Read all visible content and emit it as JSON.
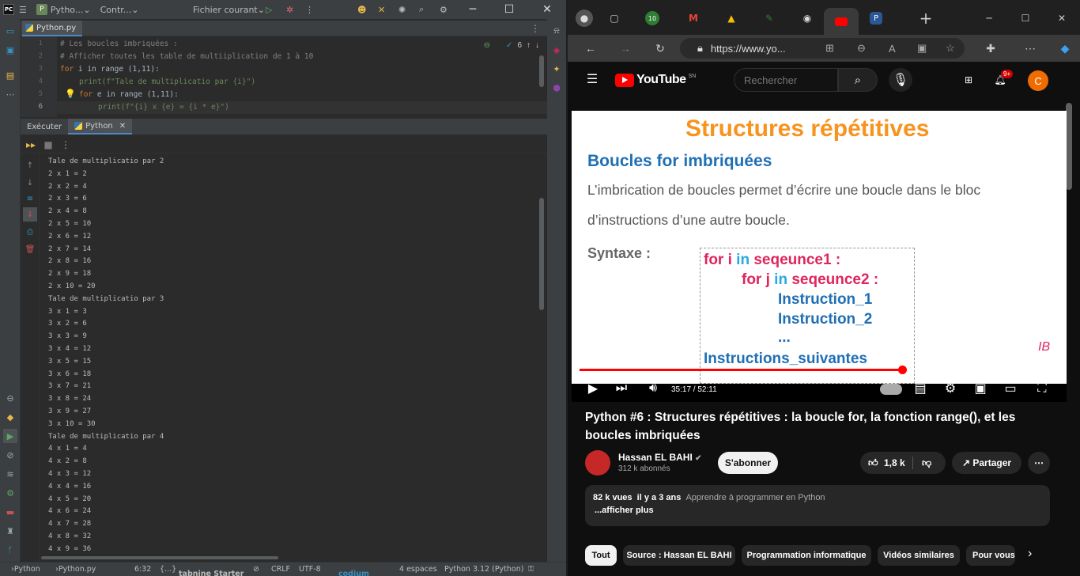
{
  "ide": {
    "project": "Pytho...",
    "project_badge": "P",
    "branch": "Contr...",
    "run_config": "Fichier courant",
    "file_tab": "Python.py",
    "inspection_count": "6",
    "code": {
      "line_numbers": [
        "1",
        "2",
        "3",
        "4",
        "5",
        "6"
      ],
      "l1": "# Les boucles imbriquées :",
      "l2": "# Afficher toutes les table de multiiplication de 1 à 10",
      "l3_kw": "for",
      "l3_rest": " i in range (1,11):",
      "l4": "print(f\"Tale de multiplicatio par {i}\")",
      "l5_kw": "for",
      "l5_rest": " e in range (1,11):",
      "l6": "print(f\"{i} x {e} = {i * e}\")"
    },
    "run_tabs": [
      "Exécuter",
      "Python"
    ],
    "console": [
      "Tale de multiplicatio par 2",
      "2 x 1 = 2",
      "2 x 2 = 4",
      "2 x 3 = 6",
      "2 x 4 = 8",
      "2 x 5 = 10",
      "2 x 6 = 12",
      "2 x 7 = 14",
      "2 x 8 = 16",
      "2 x 9 = 18",
      "2 x 10 = 20",
      "Tale de multiplicatio par 3",
      "3 x 1 = 3",
      "3 x 2 = 6",
      "3 x 3 = 9",
      "3 x 4 = 12",
      "3 x 5 = 15",
      "3 x 6 = 18",
      "3 x 7 = 21",
      "3 x 8 = 24",
      "3 x 9 = 27",
      "3 x 10 = 30",
      "Tale de multiplicatio par 4",
      "4 x 1 = 4",
      "4 x 2 = 8",
      "4 x 3 = 12",
      "4 x 4 = 16",
      "4 x 5 = 20",
      "4 x 6 = 24",
      "4 x 7 = 28",
      "4 x 8 = 32",
      "4 x 9 = 36"
    ],
    "status": {
      "crumb1": "Python",
      "crumb2": "Python.py",
      "pos": "6:32",
      "braces": "{...}",
      "tabnine": "tabnine Starter",
      "crlf": "CRLF",
      "enc": "UTF-8",
      "codium": "codium",
      "indent": "4 espaces",
      "interp": "Python 3.12 (Python)"
    }
  },
  "browser": {
    "url": "https://www.yo...",
    "tab_badge": "10",
    "tab_p": "P",
    "youtube": {
      "logo": "YouTube",
      "region": "SN",
      "search_placeholder": "Rechercher",
      "notif_count": "9+",
      "avatar": "C",
      "slide": {
        "title": "Structures répétitives",
        "subtitle": "Boucles for imbriquées",
        "p1": "L’imbrication de boucles permet d’écrire une boucle dans le bloc",
        "p2": "d’instructions d’une autre boucle.",
        "syntax_label": "Syntaxe :",
        "c1_for": "for",
        "c1_i": "i",
        "c1_in": "in",
        "c1_seq": "seqeunce1 :",
        "c2_for": "for",
        "c2_j": "j",
        "c2_in": "in",
        "c2_seq": "seqeunce2 :",
        "c3": "Instruction_1",
        "c4": "Instruction_2",
        "c5": "...",
        "c6": "Instructions_suivantes",
        "watermark": "IB"
      },
      "progress": 0.674,
      "time": "35:17 / 52:11",
      "video_title": "Python #6 : Structures répétitives : la boucle for, la fonction range(), et les boucles imbriquées",
      "channel": "Hassan EL BAHI",
      "subscribers": "312 k abonnés",
      "subscribe": "S'abonner",
      "likes": "1,8 k",
      "share": "Partager",
      "views": "82 k vues",
      "age": "il y a 3 ans",
      "hashtag": "Apprendre à programmer en Python",
      "show_more": "...afficher plus",
      "chips": [
        "Tout",
        "Source : Hassan EL BAHI",
        "Programmation informatique",
        "Vidéos similaires",
        "Pour vous"
      ]
    }
  },
  "colors": {
    "accent": "#4a88c7",
    "yt_red": "#ff0000",
    "orange": "#f7931e",
    "blue": "#1f6fb5"
  }
}
